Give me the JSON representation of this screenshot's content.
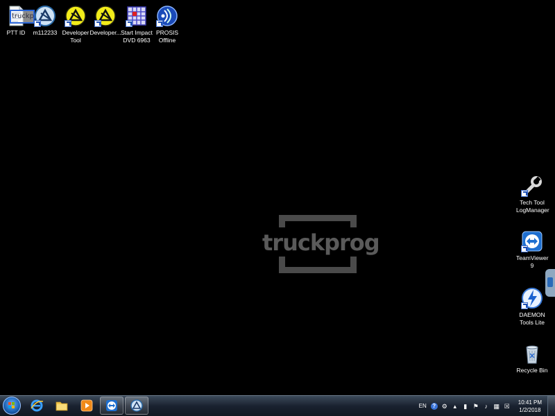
{
  "desktop": {
    "top_icons": [
      {
        "label": "PTT ID",
        "icon": "document-icon"
      },
      {
        "label": "m112233",
        "icon": "caterpillar-shortcut-icon"
      },
      {
        "label": "Developer\nTool",
        "icon": "developer-tool-icon"
      },
      {
        "label": "Developer...",
        "icon": "developer-tool-icon"
      },
      {
        "label": "Start Impact\nDVD 6963",
        "icon": "impact-grid-icon"
      },
      {
        "label": "PROSIS\nOffline",
        "icon": "prosis-icon"
      }
    ],
    "right_icons": [
      {
        "label": "Tech Tool\nLogManager",
        "icon": "wrench-icon"
      },
      {
        "label": "TeamViewer\n9",
        "icon": "teamviewer-icon"
      },
      {
        "label": "DAEMON\nTools Lite",
        "icon": "daemon-tools-icon"
      },
      {
        "label": "Recycle Bin",
        "icon": "recycle-bin-icon"
      }
    ],
    "overlay_text": "truckpr",
    "watermark": "truckprog"
  },
  "taskbar": {
    "pinned": [
      "internet-explorer-icon",
      "folder-icon",
      "media-player-icon",
      "teamviewer-icon",
      "caterpillar-icon"
    ],
    "tray": {
      "language": "EN",
      "help": "?",
      "time": "10:41 PM",
      "date": "1/2/2018"
    }
  }
}
